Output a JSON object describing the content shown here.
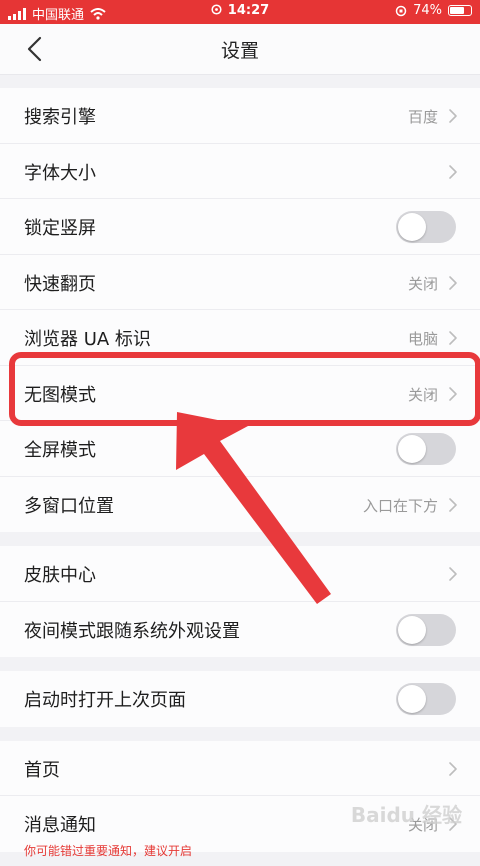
{
  "status": {
    "carrier": "中国联通",
    "time": "14:27",
    "battery": "74%",
    "battery_level": 0.74
  },
  "nav": {
    "title": "设置"
  },
  "groups": [
    [
      {
        "label": "搜索引擎",
        "value": "百度",
        "type": "link"
      },
      {
        "label": "字体大小",
        "value": "",
        "type": "link"
      },
      {
        "label": "锁定竖屏",
        "type": "toggle",
        "on": false
      },
      {
        "label": "快速翻页",
        "value": "关闭",
        "type": "link"
      },
      {
        "label": "浏览器 UA 标识",
        "value": "电脑",
        "type": "link"
      },
      {
        "label": "无图模式",
        "value": "关闭",
        "type": "link"
      },
      {
        "label": "全屏模式",
        "type": "toggle",
        "on": false
      },
      {
        "label": "多窗口位置",
        "value": "入口在下方",
        "type": "link"
      }
    ],
    [
      {
        "label": "皮肤中心",
        "value": "",
        "type": "link"
      },
      {
        "label": "夜间模式跟随系统外观设置",
        "type": "toggle",
        "on": false
      }
    ],
    [
      {
        "label": "启动时打开上次页面",
        "type": "toggle",
        "on": false
      }
    ],
    [
      {
        "label": "首页",
        "value": "",
        "type": "link"
      },
      {
        "label": "消息通知",
        "value": "关闭",
        "type": "link",
        "sub": "你可能错过重要通知，建议开启"
      }
    ]
  ],
  "watermark": "Baidu 经验",
  "colors": {
    "accent": "#e63535",
    "highlight": "#e8393c"
  }
}
